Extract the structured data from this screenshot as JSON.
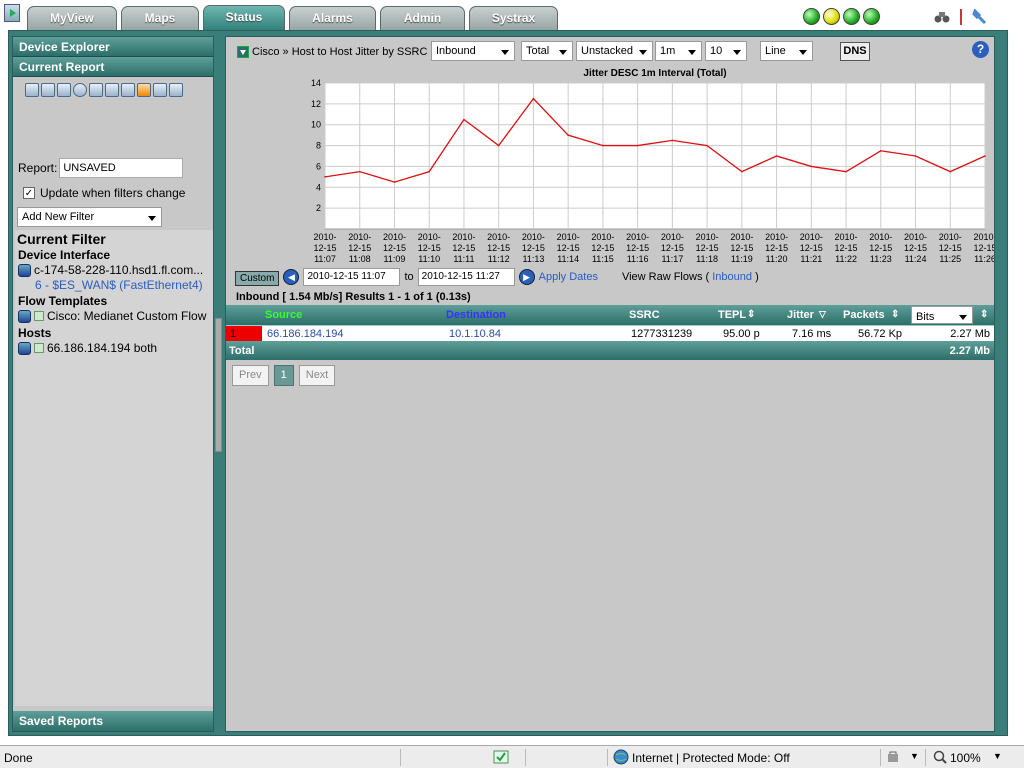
{
  "tabs": [
    {
      "label": "MyView",
      "active": false
    },
    {
      "label": "Maps",
      "active": false
    },
    {
      "label": "Status",
      "active": true
    },
    {
      "label": "Alarms",
      "active": false
    },
    {
      "label": "Admin",
      "active": false
    },
    {
      "label": "Systrax",
      "active": false
    }
  ],
  "status_lights": [
    "green",
    "yellow",
    "green",
    "green"
  ],
  "sidebar": {
    "device_explorer": "Device Explorer",
    "current_report": "Current Report",
    "report_label": "Report:",
    "report_value": "UNSAVED",
    "update_checkbox_label": "Update when filters change",
    "update_checked": true,
    "add_filter": "Add New Filter",
    "current_filter": "Current Filter",
    "device_interface_title": "Device Interface",
    "device_name": "c-174-58-228-110.hsd1.fl.com...",
    "interface_name": "6 - $ES_WAN$ (FastEthernet4)",
    "flow_templates_title": "Flow Templates",
    "flow_template": "Cisco: Medianet Custom Flow",
    "hosts_title": "Hosts",
    "host": "66.186.184.194 both",
    "saved_reports": "Saved Reports"
  },
  "controls": {
    "breadcrumb": "Cisco » Host to Host Jitter by SSRC",
    "direction": "Inbound",
    "total": "Total",
    "stacking": "Unstacked",
    "interval": "1m",
    "count": "10",
    "graph_type": "Line",
    "dns": "DNS",
    "help": "?"
  },
  "chart_data": {
    "type": "line",
    "title": "Jitter DESC 1m Interval (Total)",
    "ylim": [
      0,
      14
    ],
    "yticks": [
      2,
      4,
      6,
      8,
      10,
      12,
      14
    ],
    "x_labels": [
      "2010-12-15 11:07",
      "2010-12-15 11:08",
      "2010-12-15 11:09",
      "2010-12-15 11:10",
      "2010-12-15 11:11",
      "2010-12-15 11:12",
      "2010-12-15 11:13",
      "2010-12-15 11:14",
      "2010-12-15 11:15",
      "2010-12-15 11:16",
      "2010-12-15 11:17",
      "2010-12-15 11:18",
      "2010-12-15 11:19",
      "2010-12-15 11:20",
      "2010-12-15 11:21",
      "2010-12-15 11:22",
      "2010-12-15 11:23",
      "2010-12-15 11:24",
      "2010-12-15 11:25",
      "2010-12-15 11:26"
    ],
    "series": [
      {
        "values": [
          5.0,
          5.5,
          4.5,
          5.5,
          10.5,
          8.0,
          12.5,
          9.0,
          8.0,
          8.0,
          8.5,
          8.0,
          5.5,
          7.0,
          6.0,
          5.5,
          7.5,
          7.0,
          5.5,
          7.0
        ],
        "color": "#e01010"
      }
    ],
    "grid": true
  },
  "dates": {
    "custom": "Custom",
    "start": "2010-12-15 11:07",
    "to": "to",
    "end": "2010-12-15 11:27",
    "apply": "Apply Dates",
    "raw_prefix": "View Raw Flows (",
    "raw_link": "Inbound",
    "raw_suffix": ")"
  },
  "summary": "Inbound [ 1.54 Mb/s] Results 1 - 1 of 1 (0.13s)",
  "table": {
    "headers": {
      "source": "Source",
      "destination": "Destination",
      "ssrc": "SSRC",
      "tepl": "TEPL",
      "jitter": "Jitter",
      "packets": "Packets",
      "unit": "Bits"
    },
    "rows": [
      {
        "rank": "1",
        "source": "66.186.184.194",
        "destination": "10.1.10.84",
        "ssrc": "1277331239",
        "tepl": "95.00 p",
        "jitter": "7.16 ms",
        "packets": "56.72 Kp",
        "bits": "2.27 Mb"
      }
    ],
    "total_label": "Total",
    "total_value": "2.27 Mb"
  },
  "pager": {
    "prev": "Prev",
    "page": "1",
    "next": "Next"
  },
  "statusbar": {
    "left": "Done",
    "zone": "Internet | Protected Mode: Off",
    "zoom": "100%"
  }
}
